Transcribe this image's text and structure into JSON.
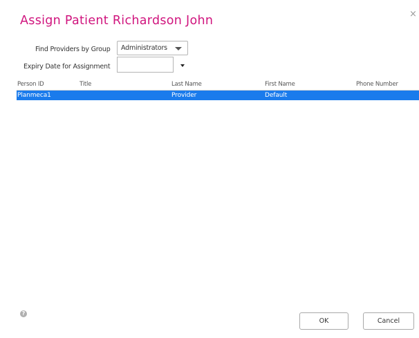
{
  "dialog": {
    "title": "Assign Patient Richardson John",
    "close_glyph": "×"
  },
  "form": {
    "group_label": "Find Providers by Group",
    "group_value": "Administrators",
    "expiry_label": "Expiry Date for Assignment",
    "expiry_value": ""
  },
  "table": {
    "columns": [
      "Person ID",
      "Title",
      "Last Name",
      "First Name",
      "Phone Number"
    ],
    "rows": [
      {
        "person_id": "Planmeca1",
        "title": "",
        "last_name": "Provider",
        "first_name": "Default",
        "phone": "",
        "selected": true
      }
    ]
  },
  "footer": {
    "help_glyph": "?",
    "ok_label": "OK",
    "cancel_label": "Cancel"
  },
  "colors": {
    "title": "#d0157e",
    "selected_row": "#1a7bec"
  }
}
